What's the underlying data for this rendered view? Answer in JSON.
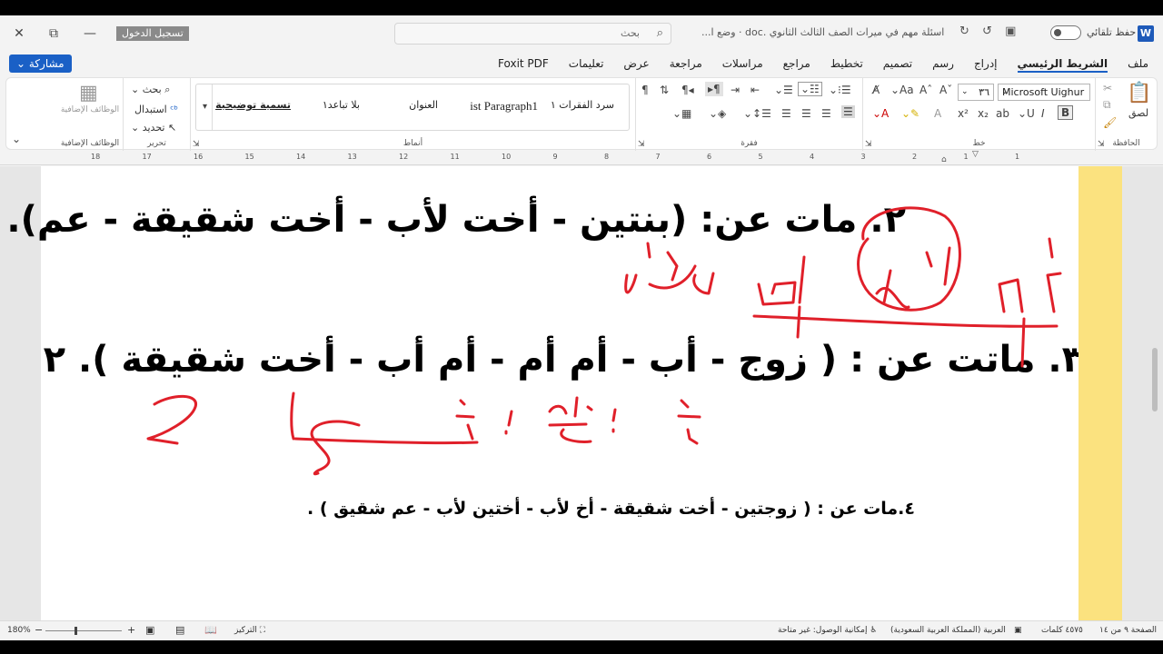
{
  "window": {
    "signin_label": "تسجيل الدخول",
    "search_placeholder": "بحث",
    "doc_title": "اسئلة مهم في  ميرات الصف الثالث الثانوي .doc  ·  وضع ا...",
    "autosave_label": "حفظ تلقائي",
    "app_logo": "W",
    "close_glyph": "✕",
    "restore_glyph": "⧉",
    "minimize_glyph": "—"
  },
  "ribbon": {
    "share_label": "مشاركة",
    "tabs": [
      "ملف",
      "الشريط الرئيسي",
      "إدراج",
      "رسم",
      "تصميم",
      "تخطيط",
      "مراجع",
      "مراسلات",
      "مراجعة",
      "عرض",
      "تعليمات",
      "Foxit PDF"
    ],
    "active_tab": "الشريط الرئيسي",
    "clipboard": {
      "paste_label": "لصق",
      "group_label": "الحافظة"
    },
    "font": {
      "font_name": "Microsoft Uighur",
      "font_size": "٣٦",
      "group_label": "خط"
    },
    "paragraph": {
      "group_label": "فقرة"
    },
    "styles": {
      "items": [
        "سرد الفقرات ١",
        "ist Paragraph1",
        "العنوان",
        "بلا تباعد١",
        "تسمية توضيحية"
      ],
      "group_label": "أنماط"
    },
    "editing": {
      "find_label": "بحث",
      "replace_label": "استبدال",
      "select_label": "تحديد",
      "group_label": "تحرير"
    },
    "addins": {
      "label": "الوظائف الإضافية",
      "group_label": "الوظائف الإضافية"
    }
  },
  "ruler": {
    "numbers": [
      "18",
      "17",
      "16",
      "15",
      "14",
      "13",
      "12",
      "11",
      "10",
      "9",
      "8",
      "7",
      "6",
      "5",
      "4",
      "3",
      "2",
      "1",
      "1"
    ]
  },
  "document": {
    "lines": [
      "٢.    مات عن: (بنتين   - أخت لأب   - أخت شقيقة  - عم).",
      "٣.    ماتت عن : ( زوج - أب - أم أم - أم أب - أخت شقيقة ). ٢",
      "٤.مات عن : ( زوجتين - أخت شقيقة - أخ لأب - أختين لأب - عم شقيق ) ."
    ],
    "ink_color": "#e0202a"
  },
  "statusbar": {
    "page": "الصفحة ٩ من ١٤",
    "words": "٤٥٧٥ كلمات",
    "language": "العربية (المملكة العربية السعودية)",
    "accessibility": "إمكانية الوصول: غير متاحة",
    "focus": "التركيز",
    "zoom": "180%"
  }
}
